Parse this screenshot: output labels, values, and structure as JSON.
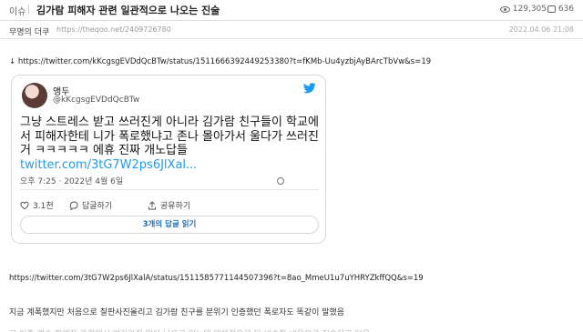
{
  "header": {
    "category": "이슈",
    "title": "김가람 피해자 관련 일관적으로 나오는 진술",
    "views": "129,305",
    "comments": "636"
  },
  "meta": {
    "author": "무명의 더쿠",
    "url": "https://theqoo.net/2409726780",
    "date": "2022.04.06 21:08"
  },
  "source1": "↓ https://twitter.com/kKcgsgEVDdQcBTw/status/1511666392449253380?t=fKMb-Uu4yzbjAyBArcTbVw&s=19",
  "tweet": {
    "name": "앵두",
    "handle": "@kKcgsgEVDdQcBTw",
    "text": "그냥 스트레스 받고 쓰러진게 아니라 김가람 친구들이 학교에서 피해자한테 니가 폭로했냐고 존나 몰아가서 울다가 쓰러진거 ㅋㅋㅋㅋㅋ 에휴 진짜 개노답들",
    "link": "twitter.com/3tG7W2ps6JlXal...",
    "time": "오후 7:25 · 2022년 4월 6일",
    "likes": "3.1천",
    "reply_label": "답글하기",
    "share_label": "공유하기",
    "read_replies": "3개의 답글 읽기"
  },
  "source2": "https://twitter.com/3tG7W2ps6JlXalA/status/1511585771144507396?t=8ao_MmeU1u7uYHRYZkffQQ&s=19",
  "body_text": "지금 계폭했지만 처음으로 칠판사진올리고 김가람 친구를 분위기 인증했던 폭로자도 똑같이 말했음",
  "cut_text": "그 이후 계속 피해자 관련해서 여러가지 말이 나오고 있는데 대체적으로 다 비슷한 내용으로 진술하고 있음",
  "colors": {
    "link": "#1d9bf0",
    "twitter_blue": "#1d9bf0",
    "reply_button": "#1d6fc0"
  },
  "icons": [
    "eye-icon",
    "comment-icon",
    "twitter-bird-icon",
    "info-icon",
    "heart-icon",
    "reply-icon",
    "share-icon"
  ]
}
